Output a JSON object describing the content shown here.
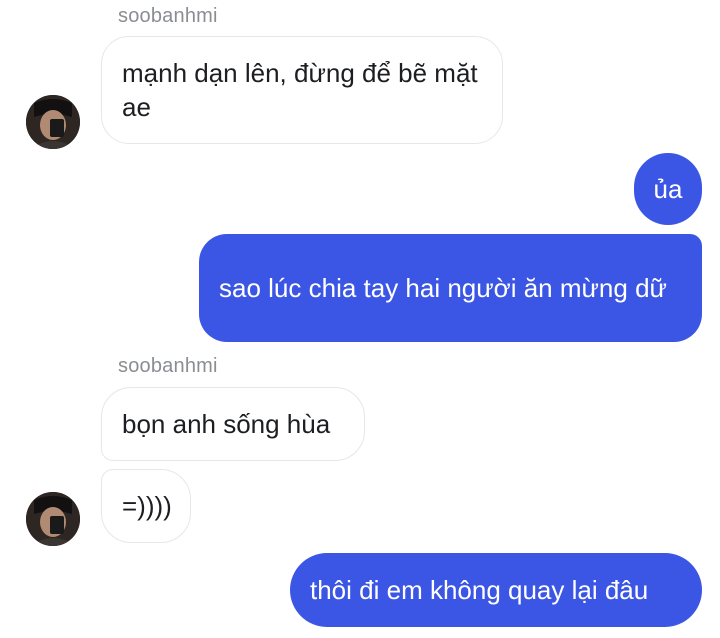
{
  "conversation": {
    "messages": [
      {
        "sender": "soobanhmi",
        "text": "mạnh dạn lên, đừng để bẽ mặt ae",
        "direction": "incoming"
      },
      {
        "text": "ủa",
        "direction": "outgoing"
      },
      {
        "text": "sao lúc chia tay hai người ăn mừng dữ",
        "direction": "outgoing"
      },
      {
        "sender": "soobanhmi",
        "text": "bọn anh sống hùa",
        "direction": "incoming"
      },
      {
        "text": "=))))",
        "direction": "incoming"
      },
      {
        "text": "thôi đi em không quay lại đâu",
        "direction": "outgoing"
      }
    ]
  },
  "colors": {
    "outgoing_bubble": "#3b56e4",
    "incoming_bubble": "#ffffff",
    "incoming_border": "#e6e7ea",
    "sender_name": "#8a8d91"
  },
  "icons": {
    "avatar": "profile-photo"
  }
}
